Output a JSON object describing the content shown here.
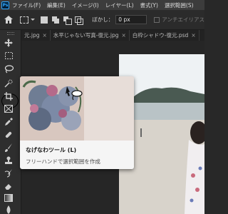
{
  "menubar": {
    "logo": "Ps",
    "items": [
      "ファイル(F)",
      "編集(E)",
      "イメージ(I)",
      "レイヤー(L)",
      "書式(Y)",
      "選択範囲(S)"
    ]
  },
  "options": {
    "feather_label": "ぼかし：",
    "feather_value": "0 px",
    "antialias_label": "アンチエイリアス"
  },
  "tabs": [
    {
      "label": "元.jpg",
      "close": "×"
    },
    {
      "label": "水平じゃない写真-復元.jpg",
      "close": "×"
    },
    {
      "label": "白枠シャドウ-復元.psd",
      "close": "×"
    }
  ],
  "tooltip": {
    "title": "なげなわツール (L)",
    "description": "フリーハンドで選択範囲を作成"
  },
  "colors": {
    "selection_ring": "#000000",
    "accent": "#31a8ff"
  }
}
